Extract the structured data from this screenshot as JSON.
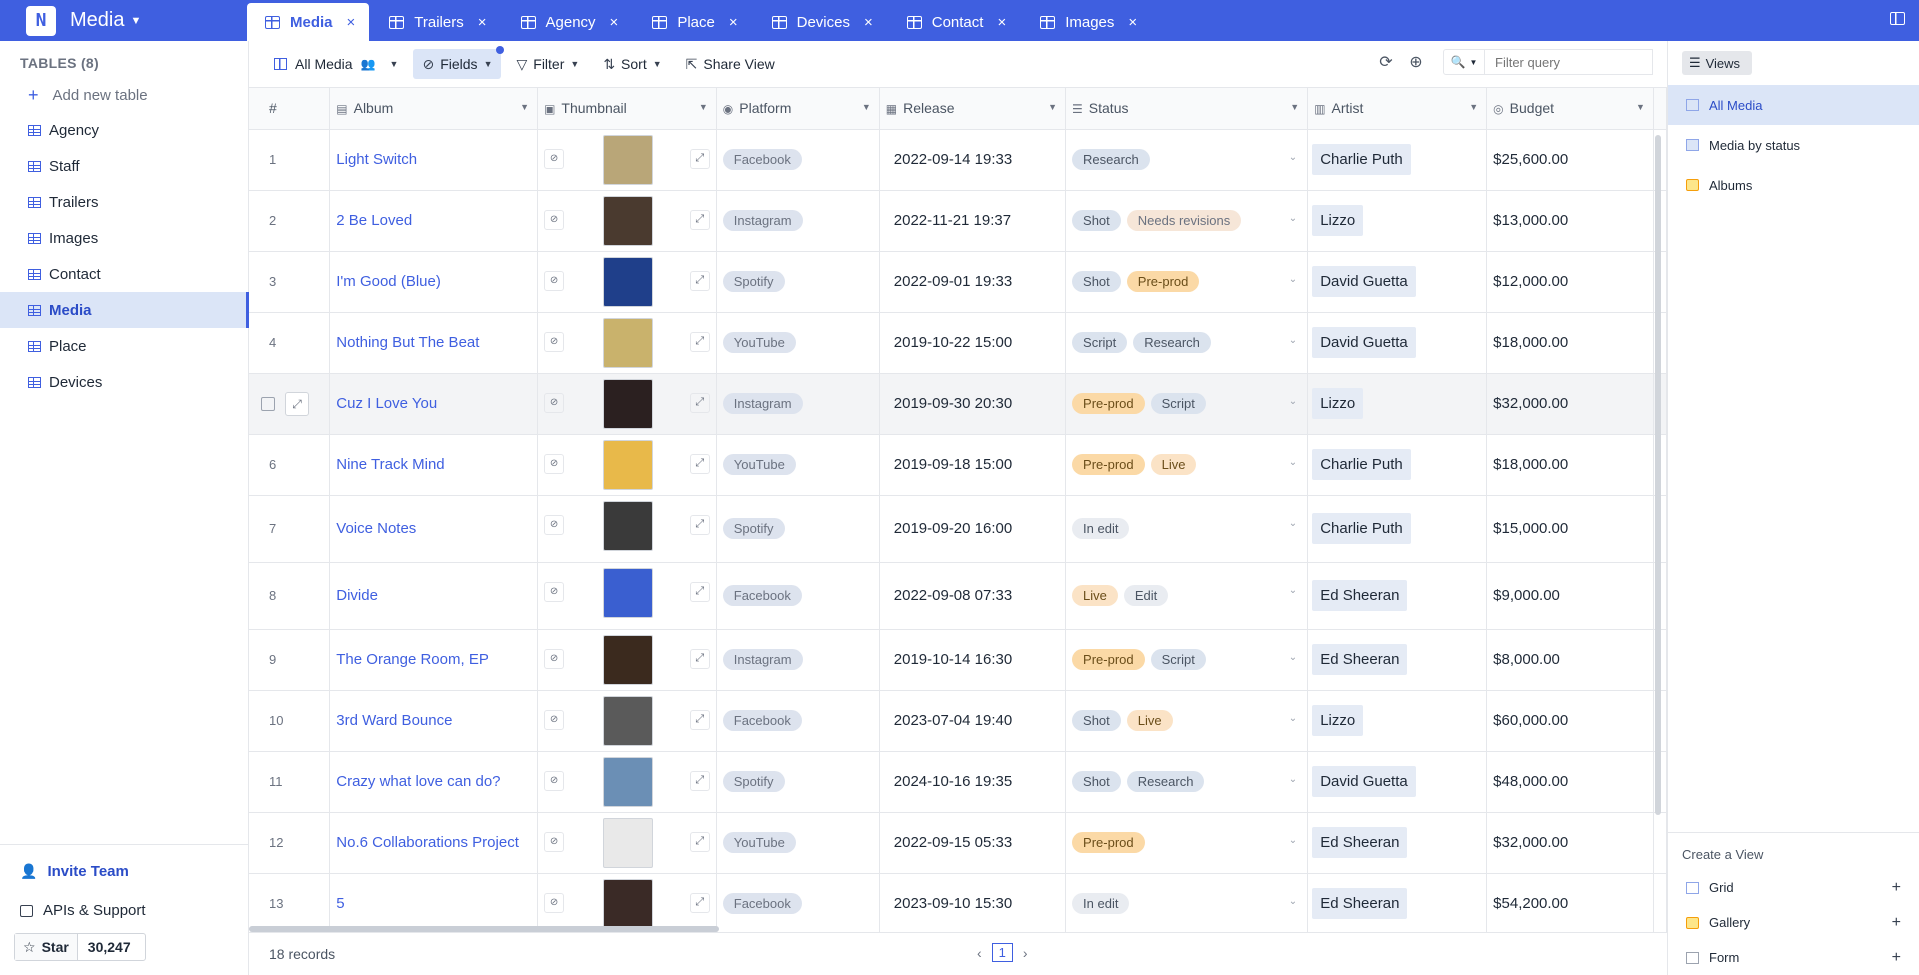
{
  "app": {
    "name": "Media"
  },
  "tabs": [
    {
      "label": "Media",
      "active": true
    },
    {
      "label": "Trailers"
    },
    {
      "label": "Agency"
    },
    {
      "label": "Place"
    },
    {
      "label": "Devices"
    },
    {
      "label": "Contact"
    },
    {
      "label": "Images"
    }
  ],
  "sidebar": {
    "heading": "TABLES (8)",
    "add_label": "Add new table",
    "items": [
      "Agency",
      "Staff",
      "Trailers",
      "Images",
      "Contact",
      "Media",
      "Place",
      "Devices"
    ],
    "active": "Media",
    "invite": "Invite Team",
    "apis": "APIs & Support",
    "star_label": "Star",
    "star_count": "30,247"
  },
  "toolbar": {
    "view_name": "All Media",
    "fields": "Fields",
    "filter": "Filter",
    "sort": "Sort",
    "share": "Share View",
    "search_placeholder": "Filter query"
  },
  "columns": {
    "num": "#",
    "album": "Album",
    "thumbnail": "Thumbnail",
    "platform": "Platform",
    "release": "Release",
    "status": "Status",
    "artist": "Artist",
    "budget": "Budget"
  },
  "rows": [
    {
      "n": "1",
      "album": "Light Switch",
      "thumb": "#b9a678",
      "platform": "Facebook",
      "release": "2022-09-14 19:33",
      "status": [
        "Research"
      ],
      "artist": "Charlie Puth",
      "budget": "$25,600.00"
    },
    {
      "n": "2",
      "album": "2 Be Loved",
      "thumb": "#4a3a2f",
      "platform": "Instagram",
      "release": "2022-11-21 19:37",
      "status": [
        "Shot",
        "Needs revisions"
      ],
      "artist": "Lizzo",
      "budget": "$13,000.00"
    },
    {
      "n": "3",
      "album": "I'm Good (Blue)",
      "thumb": "#1f3f8a",
      "platform": "Spotify",
      "release": "2022-09-01 19:33",
      "status": [
        "Shot",
        "Pre-prod"
      ],
      "artist": "David Guetta",
      "budget": "$12,000.00"
    },
    {
      "n": "4",
      "album": "Nothing But The Beat",
      "thumb": "#c9b26c",
      "platform": "YouTube",
      "release": "2019-10-22 15:00",
      "status": [
        "Script",
        "Research"
      ],
      "artist": "David Guetta",
      "budget": "$18,000.00"
    },
    {
      "n": "",
      "album": "Cuz I Love You",
      "thumb": "#2b2020",
      "platform": "Instagram",
      "release": "2019-09-30 20:30",
      "status": [
        "Pre-prod",
        "Script"
      ],
      "artist": "Lizzo",
      "budget": "$32,000.00",
      "hover": true
    },
    {
      "n": "6",
      "album": "Nine Track Mind",
      "thumb": "#e8b94a",
      "platform": "YouTube",
      "release": "2019-09-18 15:00",
      "status": [
        "Pre-prod",
        "Live"
      ],
      "artist": "Charlie Puth",
      "budget": "$18,000.00"
    },
    {
      "n": "7",
      "album": "Voice Notes",
      "thumb": "#3a3a3a",
      "platform": "Spotify",
      "release": "2019-09-20 16:00",
      "status": [
        "In edit"
      ],
      "artist": "Charlie Puth",
      "budget": "$15,000.00"
    },
    {
      "n": "8",
      "album": "Divide",
      "thumb": "#3a5fd0",
      "platform": "Facebook",
      "release": "2022-09-08 07:33",
      "status": [
        "Live",
        "Edit"
      ],
      "artist": "Ed Sheeran",
      "budget": "$9,000.00"
    },
    {
      "n": "9",
      "album": "The Orange Room, EP",
      "thumb": "#3b2a1e",
      "platform": "Instagram",
      "release": "2019-10-14 16:30",
      "status": [
        "Pre-prod",
        "Script"
      ],
      "artist": "Ed Sheeran",
      "budget": "$8,000.00"
    },
    {
      "n": "10",
      "album": "3rd Ward Bounce",
      "thumb": "#5a5a5a",
      "platform": "Facebook",
      "release": "2023-07-04 19:40",
      "status": [
        "Shot",
        "Live"
      ],
      "artist": "Lizzo",
      "budget": "$60,000.00"
    },
    {
      "n": "11",
      "album": "Crazy what love can do?",
      "thumb": "#6b8fb5",
      "platform": "Spotify",
      "release": "2024-10-16 19:35",
      "status": [
        "Shot",
        "Research"
      ],
      "artist": "David Guetta",
      "budget": "$48,000.00"
    },
    {
      "n": "12",
      "album": "No.6 Collaborations Project",
      "thumb": "#e9e9e9",
      "platform": "YouTube",
      "release": "2022-09-15 05:33",
      "status": [
        "Pre-prod"
      ],
      "artist": "Ed Sheeran",
      "budget": "$32,000.00"
    },
    {
      "n": "13",
      "album": "5",
      "thumb": "#3a2a26",
      "platform": "Facebook",
      "release": "2023-09-10 15:30",
      "status": [
        "In edit"
      ],
      "artist": "Ed Sheeran",
      "budget": "$54,200.00"
    }
  ],
  "footer": {
    "records": "18 records",
    "page": "1"
  },
  "views": {
    "button": "Views",
    "list": [
      "All Media",
      "Media by status",
      "Albums"
    ],
    "active": "All Media",
    "create_title": "Create a View",
    "create": [
      "Grid",
      "Gallery",
      "Form"
    ]
  }
}
